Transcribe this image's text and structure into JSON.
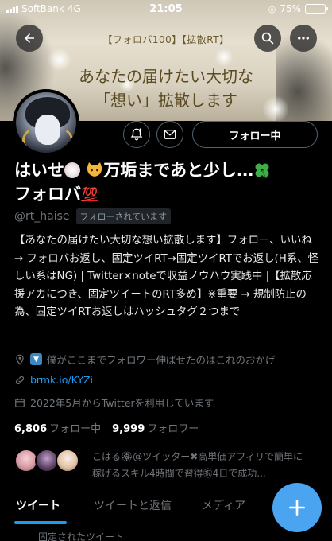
{
  "status_bar": {
    "carrier": "SoftBank",
    "network": "4G",
    "time": "21:05",
    "battery": "75%",
    "battery_level": 0.75
  },
  "banner": {
    "tag": "【フォロバ100】【拡散RT】",
    "line1": "あなたの届けたい大切な",
    "line2": "「想い」拡散します"
  },
  "header": {
    "back_icon": "arrow-left-icon",
    "search_icon": "search-icon",
    "more_icon": "more-horizontal-icon"
  },
  "actions": {
    "notify_icon": "bell-plus-icon",
    "message_icon": "envelope-icon",
    "follow_label": "フォロー中"
  },
  "profile": {
    "display_name_part1": "はいせ",
    "display_name_part2": "万垢まであと少し…",
    "display_name_part3": "フォロバ",
    "emoji_1": "🏵",
    "emoji_2": "🐱",
    "emoji_3": "🍀",
    "emoji_4": "💯",
    "handle": "@rt_haise",
    "follows_you": "フォローされています",
    "bio": "【あなたの届けたい大切な想い拡散します】フォロー、いいね → フォロバお返し、固定ツイRT→固定ツイRTでお返し(H系、怪しい系はNG) | Twitter×noteで収益ノウハウ実践中 |【拡散応援アカにつき、固定ツイートのRT多め】※重要 → 規制防止の為、固定ツイRTお返しはハッシュタグ２つまで",
    "location_badge": "▼",
    "location": "僕がここまでフォロワー伸ばせたのはこれのおかげ",
    "link": "brmk.io/KYZi",
    "joined": "2022年5月からTwitterを利用しています",
    "following_count": "6,806",
    "following_label": "フォロー中",
    "followers_count": "9,999",
    "followers_label": "フォロワー"
  },
  "followers_preview": {
    "text": "こはる🏵@ツイッター✖高単価アフィリで簡単に稼げるスキル4時間で習得㊗4日で成功..."
  },
  "tabs": [
    {
      "label": "ツイート"
    },
    {
      "label": "ツイートと返信"
    },
    {
      "label": "メディア"
    }
  ],
  "pinned_peek": "固定されたツイート",
  "fab": {
    "icon": "plus-icon"
  },
  "colors": {
    "accent": "#1d9bf0",
    "fab": "#4ba4f0",
    "background": "#000000"
  }
}
